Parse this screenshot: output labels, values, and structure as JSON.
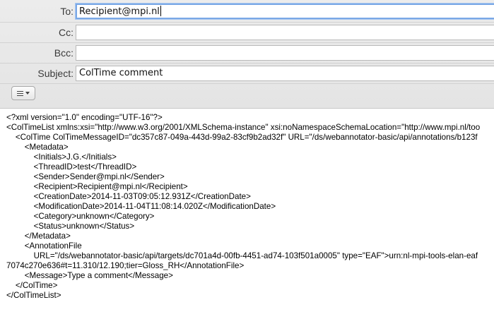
{
  "headers": {
    "to_label": "To:",
    "to_value": "Recipient@mpi.nl",
    "cc_label": "Cc:",
    "cc_value": "",
    "bcc_label": "Bcc:",
    "bcc_value": "",
    "subject_label": "Subject:",
    "subject_value": "ColTime comment"
  },
  "toolbar": {
    "format_icon": "list-format-icon",
    "dropdown_icon": "triangle-down-icon"
  },
  "body_lines": [
    "<?xml version=\"1.0\" encoding=\"UTF-16\"?>",
    "<ColTimeList xmlns:xsi=\"http://www.w3.org/2001/XMLSchema-instance\" xsi:noNamespaceSchemaLocation=\"http://www.mpi.nl/too",
    "    <ColTime ColTimeMessageID=\"dc357c87-049a-443d-99a2-83cf9b2ad32f\" URL=\"/ds/webannotator-basic/api/annotations/b123f",
    "        <Metadata>",
    "            <Initials>J.G.</Initials>",
    "            <ThreadID>test</ThreadID>",
    "            <Sender>Sender@mpi.nl</Sender>",
    "            <Recipient>Recipient@mpi.nl</Recipient>",
    "            <CreationDate>2014-11-03T09:05:12.931Z</CreationDate>",
    "            <ModificationDate>2014-11-04T11:08:14.020Z</ModificationDate>",
    "            <Category>unknown</Category>",
    "            <Status>unknown</Status>",
    "        </Metadata>",
    "        <AnnotationFile",
    "            URL=\"/ds/webannotator-basic/api/targets/dc701a4d-00fb-4451-ad74-103f501a0005\" type=\"EAF\">urn:nl-mpi-tools-elan-eaf",
    "7074c270e636#t=11.310/12.190;tier=Gloss_RH</AnnotationFile>",
    "        <Message>Type a comment</Message>",
    "    </ColTime>",
    "</ColTimeList>"
  ]
}
